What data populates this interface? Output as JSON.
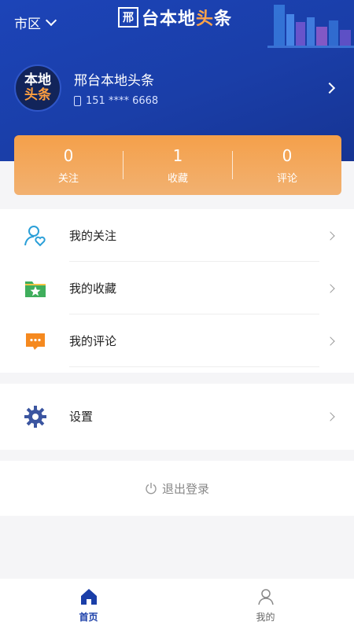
{
  "header": {
    "city": "市区",
    "brand": {
      "part1": "台本地",
      "part2": "头",
      "part3": "条"
    }
  },
  "profile": {
    "avatar_line1": "本地",
    "avatar_line2": "头条",
    "name": "邢台本地头条",
    "phone": "151 **** 6668"
  },
  "stats": [
    {
      "value": "0",
      "label": "关注"
    },
    {
      "value": "1",
      "label": "收藏"
    },
    {
      "value": "0",
      "label": "评论"
    }
  ],
  "menu": [
    {
      "label": "我的关注",
      "icon": "user-heart-icon"
    },
    {
      "label": "我的收藏",
      "icon": "folder-star-icon"
    },
    {
      "label": "我的评论",
      "icon": "comment-icon"
    }
  ],
  "settings": {
    "label": "设置",
    "icon": "gear-icon"
  },
  "logout": {
    "label": "退出登录"
  },
  "tabbar": [
    {
      "label": "首页",
      "active": true
    },
    {
      "label": "我的",
      "active": false
    }
  ],
  "colors": {
    "brand_blue": "#1a3ea8",
    "accent_orange": "#f4a04a"
  }
}
